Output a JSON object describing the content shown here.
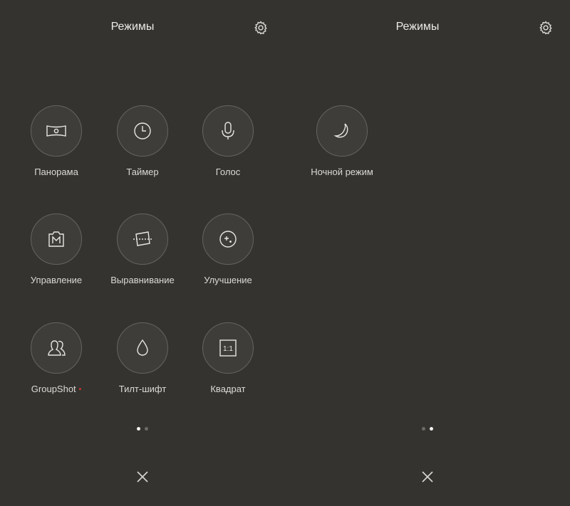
{
  "screen1": {
    "title": "Режимы",
    "modes": [
      {
        "label": "Панорама",
        "icon": "panorama-icon"
      },
      {
        "label": "Таймер",
        "icon": "timer-icon"
      },
      {
        "label": "Голос",
        "icon": "microphone-icon"
      },
      {
        "label": "Управление",
        "icon": "manual-mode-icon"
      },
      {
        "label": "Выравнивание",
        "icon": "straighten-icon"
      },
      {
        "label": "Улучшение",
        "icon": "beautify-icon"
      },
      {
        "label": "GroupShot",
        "icon": "group-icon",
        "badge": "•"
      },
      {
        "label": "Тилт-шифт",
        "icon": "drop-icon"
      },
      {
        "label": "Квадрат",
        "icon": "square-icon",
        "icon_text": "1:1"
      }
    ],
    "page_indicator": {
      "current": 1,
      "total": 2
    }
  },
  "screen2": {
    "title": "Режимы",
    "modes": [
      {
        "label": "Ночной режим",
        "icon": "moon-icon"
      }
    ],
    "page_indicator": {
      "current": 2,
      "total": 2
    }
  },
  "colors": {
    "background": "#35332f",
    "icon_stroke": "#e8e6e3",
    "badge": "#e53935"
  }
}
